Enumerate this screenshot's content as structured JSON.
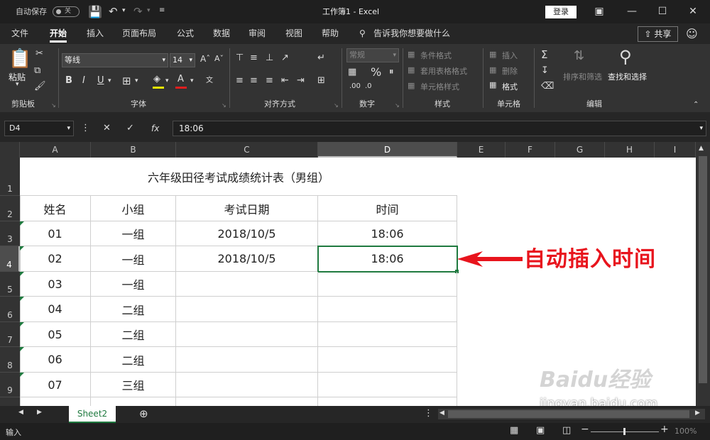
{
  "titlebar": {
    "autosave_label": "自动保存",
    "autosave_state": "关",
    "doc_title": "工作簿1 - Excel",
    "signin_label": "登录"
  },
  "menu": {
    "tabs": [
      "文件",
      "开始",
      "插入",
      "页面布局",
      "公式",
      "数据",
      "审阅",
      "视图",
      "帮助"
    ],
    "active_tab": "开始",
    "tell_me": "告诉我你想要做什么",
    "share_label": "共享"
  },
  "ribbon": {
    "clipboard": {
      "paste": "粘贴",
      "label": "剪贴板"
    },
    "font": {
      "name": "等线",
      "size": "14",
      "label": "字体"
    },
    "alignment": {
      "label": "对齐方式"
    },
    "number": {
      "format": "常规",
      "label": "数字"
    },
    "styles": {
      "conditional": "条件格式",
      "table": "套用表格格式",
      "cell_styles": "单元格样式",
      "label": "样式"
    },
    "cells": {
      "insert": "插入",
      "delete": "删除",
      "format": "格式",
      "label": "单元格"
    },
    "editing": {
      "sort_filter": "排序和筛选",
      "find_select": "查找和选择",
      "label": "编辑"
    }
  },
  "formula_bar": {
    "name_box": "D4",
    "value": "18:06"
  },
  "columns": [
    "A",
    "B",
    "C",
    "D",
    "E",
    "F",
    "G",
    "H",
    "I"
  ],
  "selected_column": "D",
  "rows": [
    "1",
    "2",
    "3",
    "4",
    "5",
    "6",
    "7",
    "8",
    "9"
  ],
  "selected_row": "4",
  "table": {
    "title": "六年级田径考试成绩统计表（男组）",
    "headers": [
      "姓名",
      "小组",
      "考试日期",
      "时间"
    ],
    "data": [
      [
        "01",
        "一组",
        "2018/10/5",
        "18:06"
      ],
      [
        "02",
        "一组",
        "2018/10/5",
        "18:06"
      ],
      [
        "03",
        "一组",
        "",
        ""
      ],
      [
        "04",
        "二组",
        "",
        ""
      ],
      [
        "05",
        "二组",
        "",
        ""
      ],
      [
        "06",
        "二组",
        "",
        ""
      ],
      [
        "07",
        "三组",
        "",
        ""
      ]
    ]
  },
  "annotation": {
    "text": "自动插入时间",
    "color": "#e8141d"
  },
  "sheet_tab": "Sheet2",
  "status": {
    "mode": "输入",
    "zoom": "100%"
  },
  "watermark": {
    "brand": "Baidu经验",
    "url": "jingyan.baidu.com"
  }
}
